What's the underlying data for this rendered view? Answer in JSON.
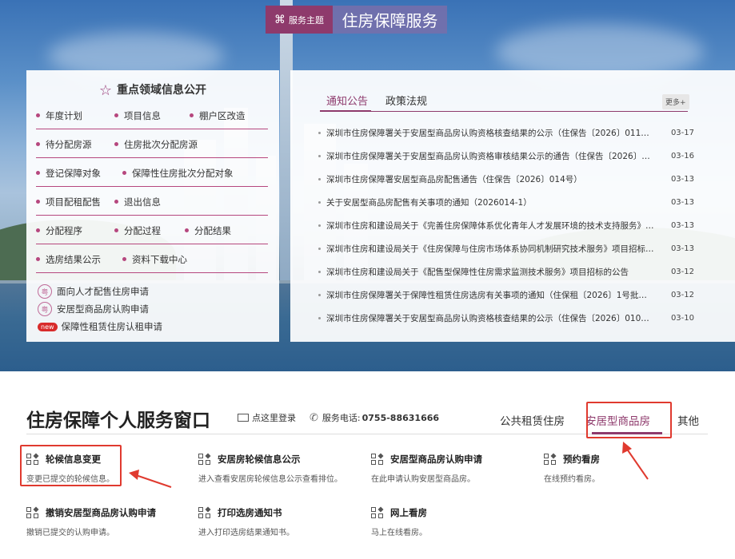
{
  "hero": {
    "theme_label": "服务主题",
    "theme_title": "住房保障服务"
  },
  "info_panel": {
    "title": "重点领域信息公开",
    "rows": [
      [
        "年度计划",
        "项目信息",
        "棚户区改造"
      ],
      [
        "待分配房源",
        "住房批次分配房源"
      ],
      [
        "登记保障对象",
        "保障性住房批次分配对象"
      ],
      [
        "项目配租配售",
        "退出信息"
      ],
      [
        "分配程序",
        "分配过程",
        "分配结果"
      ],
      [
        "选房结果公示",
        "资料下载中心"
      ]
    ],
    "applications": [
      {
        "badge": "粤",
        "label": "面向人才配售住房申请"
      },
      {
        "badge": "粤",
        "label": "安居型商品房认购申请"
      },
      {
        "badge": "new",
        "label": "保障性租赁住房认租申请"
      }
    ]
  },
  "news_panel": {
    "tabs": [
      "通知公告",
      "政策法规"
    ],
    "more": "更多+",
    "items": [
      {
        "title": "深圳市住房保障署关于安居型商品房认购资格核查结果的公示（住保告〔2026〕011号批...",
        "date": "03-17"
      },
      {
        "title": "深圳市住房保障署关于安居型商品房认购资格审核结果公示的通告（住保告〔2026〕006...",
        "date": "03-16"
      },
      {
        "title": "深圳市住房保障署安居型商品房配售通告（住保告〔2026〕014号）",
        "date": "03-13"
      },
      {
        "title": "关于安居型商品房配售有关事项的通知（2026014-1）",
        "date": "03-13"
      },
      {
        "title": "深圳市住房和建设局关于《完善住房保障体系优化青年人才发展环境的技术支持服务》项...",
        "date": "03-13"
      },
      {
        "title": "深圳市住房和建设局关于《住房保障与住房市场体系协同机制研究技术服务》项目招标的...",
        "date": "03-13"
      },
      {
        "title": "深圳市住房和建设局关于《配售型保障性住房需求监测技术服务》项目招标的公告",
        "date": "03-12"
      },
      {
        "title": "深圳市住房保障署关于保障性租赁住房选房有关事项的通知（住保租〔2026〕1号批次）",
        "date": "03-12"
      },
      {
        "title": "深圳市住房保障署关于安居型商品房认购资格核查结果的公示（住保告〔2026〕010号批...",
        "date": "03-10"
      }
    ]
  },
  "service": {
    "title": "住房保障个人服务窗口",
    "login": "点这里登录",
    "phone_label": "服务电话:",
    "phone": "0755-88631666",
    "tabs": [
      "公共租赁住房",
      "安居型商品房",
      "其他"
    ],
    "items": [
      {
        "title": "轮候信息变更",
        "desc": "变更已提交的轮候信息。"
      },
      {
        "title": "安居房轮候信息公示",
        "desc": "进入查看安居房轮候信息公示查看排位。"
      },
      {
        "title": "安居型商品房认购申请",
        "desc": "在此申请认购安居型商品房。"
      },
      {
        "title": "预约看房",
        "desc": "在线预约看房。"
      },
      {
        "title": "撤销安居型商品房认购申请",
        "desc": "撤销已提交的认购申请。"
      },
      {
        "title": "打印选房通知书",
        "desc": "进入打印选房结果通知书。"
      },
      {
        "title": "网上看房",
        "desc": "马上在线看房。"
      }
    ]
  },
  "colors": {
    "accent": "#8e3a6c",
    "highlight_box": "#e03a2f"
  }
}
